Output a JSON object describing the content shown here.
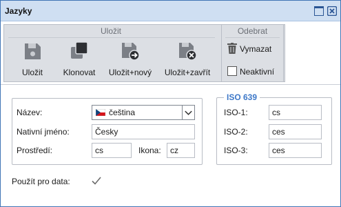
{
  "window": {
    "title": "Jazyky"
  },
  "ribbon": {
    "groups": [
      {
        "title": "Uložit"
      },
      {
        "title": "Odebrat"
      }
    ],
    "buttons": {
      "save": "Uložit",
      "clone": "Klonovat",
      "save_new": "Uložit+nový",
      "save_close": "Uložit+zavřít",
      "delete": "Vymazat",
      "inactive": "Neaktivní"
    }
  },
  "form": {
    "name_label": "Název:",
    "name_value": "čeština",
    "native_label": "Nativní jméno:",
    "native_value": "Česky",
    "env_label": "Prostředí:",
    "env_value": "cs",
    "icon_label": "Ikona:",
    "icon_value": "cz",
    "use_for_data_label": "Použít pro data:",
    "use_for_data_checked": true
  },
  "iso": {
    "legend": "ISO 639",
    "iso1_label": "ISO-1:",
    "iso1_value": "cs",
    "iso2_label": "ISO-2:",
    "iso2_value": "ces",
    "iso3_label": "ISO-3:",
    "iso3_value": "ces"
  },
  "colors": {
    "accent": "#3d78c8",
    "title_bar": "#cfdff2",
    "ribbon": "#dcdfe4"
  },
  "icons": [
    "floppy-save-icon",
    "clone-icon",
    "save-new-icon",
    "save-close-icon",
    "trash-icon",
    "maximize-icon",
    "close-icon",
    "czech-flag-icon",
    "chevron-down-icon",
    "check-icon"
  ]
}
